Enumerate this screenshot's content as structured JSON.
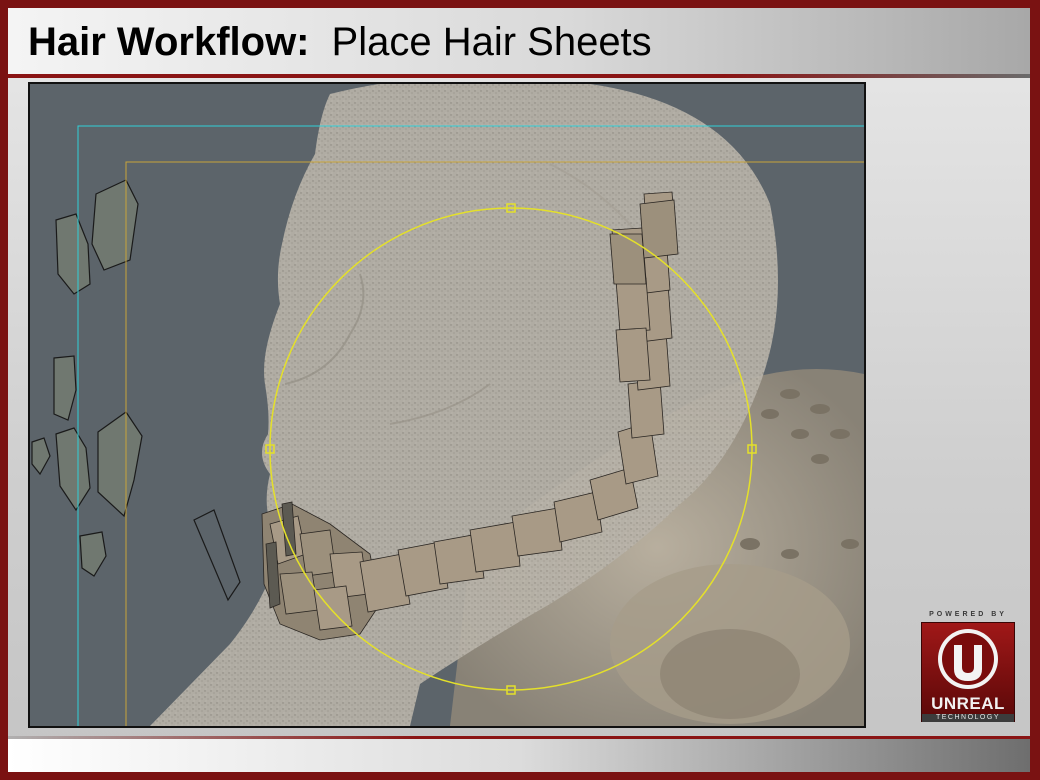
{
  "slide": {
    "title_bold": "Hair Workflow:",
    "title_sub": "Place Hair Sheets"
  },
  "badge": {
    "powered_by": "POWERED BY",
    "brand": "UNREAL",
    "tagline": "TECHNOLOGY"
  },
  "colors": {
    "frame": "#7a1212",
    "accent_red": "#8a1414",
    "viewport_bg": "#5c646a",
    "guide_cyan": "#2fd0d8",
    "guide_orange": "#c9a43a",
    "manipulator_yellow": "#e4e02a",
    "hair_sheet": "#a89a86"
  },
  "viewport": {
    "content": "3d-head-model-with-hair-sheets"
  }
}
